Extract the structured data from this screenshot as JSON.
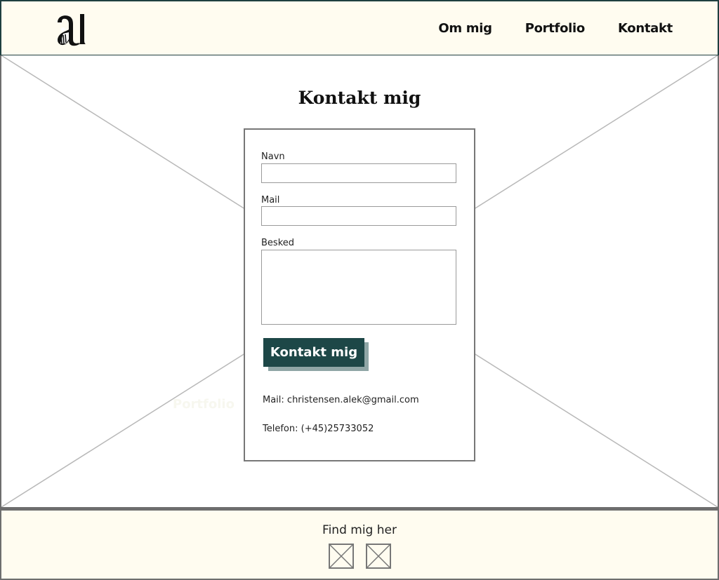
{
  "nav": {
    "items": [
      {
        "label": "Om mig"
      },
      {
        "label": "Portfolio"
      },
      {
        "label": "Kontakt"
      }
    ]
  },
  "hero": {
    "ghost_text": "Portfolio"
  },
  "contact": {
    "title": "Kontakt mig",
    "form": {
      "name_label": "Navn",
      "name_value": "",
      "mail_label": "Mail",
      "mail_value": "",
      "message_label": "Besked",
      "message_value": "",
      "submit_label": "Kontakt mig"
    },
    "mail_info": "Mail: christensen.alek@gmail.com",
    "phone_info": "Telefon: (+45)25733052"
  },
  "footer": {
    "title": "Find mig her",
    "social": [
      {
        "icon": "image-placeholder-icon"
      },
      {
        "icon": "image-placeholder-icon"
      }
    ]
  },
  "colors": {
    "header_bg": "#fffcf0",
    "header_border": "#1f3f3f",
    "button_bg": "#1d4747",
    "button_shadow": "#8fa6a6",
    "footer_bg": "#fffcf0"
  }
}
